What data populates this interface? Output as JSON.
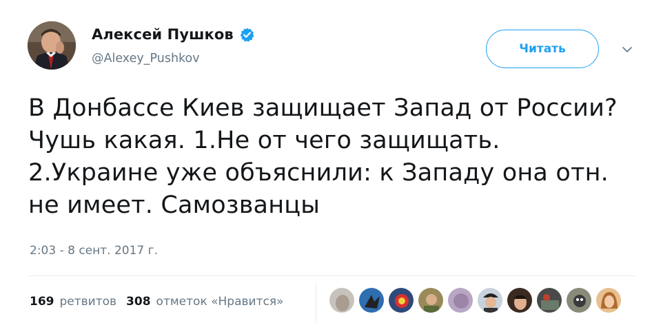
{
  "tweet": {
    "author": {
      "display_name": "Алексей Пушков",
      "handle": "@Alexey_Pushkov",
      "verified": true,
      "avatar_icon": "profile-photo"
    },
    "follow_button_label": "Читать",
    "more_icon": "chevron-down-icon",
    "text": "В Донбассе Киев защищает Запад от России? Чушь какая. 1.Не от чего защищать. 2.Украине уже объяснили: к Западу она отн. не имеет. Самозванцы",
    "timestamp": "2:03 - 8 сент. 2017 г.",
    "stats": {
      "retweets_count": "169",
      "retweets_label": "ретвитов",
      "likes_count": "308",
      "likes_label": "отметок «Нравится»"
    },
    "liker_avatars_count": 9,
    "colors": {
      "accent": "#1da1f2",
      "text": "#14171a",
      "secondary_text": "#657786",
      "divider": "#e6ecf0"
    }
  }
}
